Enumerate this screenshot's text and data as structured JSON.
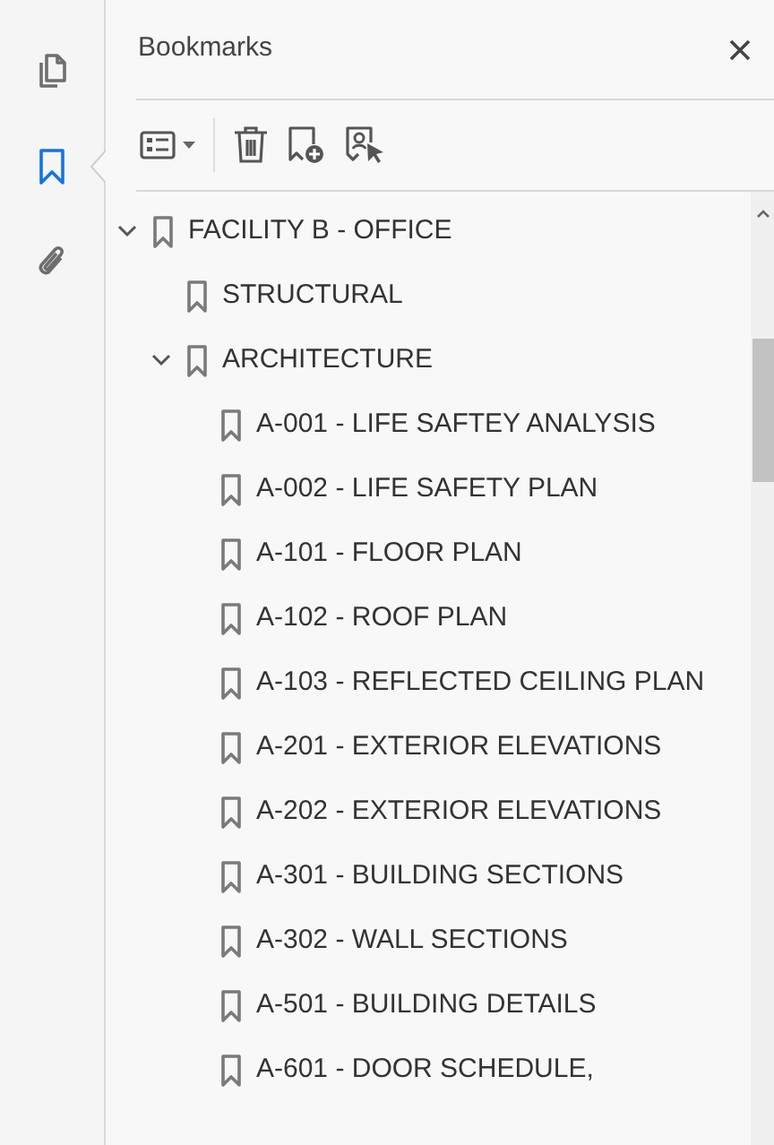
{
  "rail": [
    {
      "kind": "pages",
      "selected": false
    },
    {
      "kind": "bookmarks",
      "selected": true
    },
    {
      "kind": "attachments",
      "selected": false
    }
  ],
  "panel": {
    "title": "Bookmarks"
  },
  "tree": [
    {
      "label": "FACILITY B - OFFICE",
      "expanded": true,
      "children": [
        {
          "label": "STRUCTURAL"
        },
        {
          "label": "ARCHITECTURE",
          "expanded": true,
          "children": [
            {
              "label": "A-001 - LIFE SAFTEY ANALYSIS"
            },
            {
              "label": "A-002 - LIFE SAFETY PLAN"
            },
            {
              "label": "A-101 - FLOOR PLAN"
            },
            {
              "label": "A-102 - ROOF PLAN"
            },
            {
              "label": "A-103 - REFLECTED CEILING PLAN"
            },
            {
              "label": "A-201 - EXTERIOR ELEVATIONS"
            },
            {
              "label": "A-202 - EXTERIOR ELEVATIONS"
            },
            {
              "label": "A-301 - BUILDING SECTIONS"
            },
            {
              "label": "A-302 - WALL SECTIONS"
            },
            {
              "label": "A-501 - BUILDING DETAILS"
            },
            {
              "label": "A-601 - DOOR SCHEDULE,"
            }
          ]
        }
      ]
    }
  ]
}
